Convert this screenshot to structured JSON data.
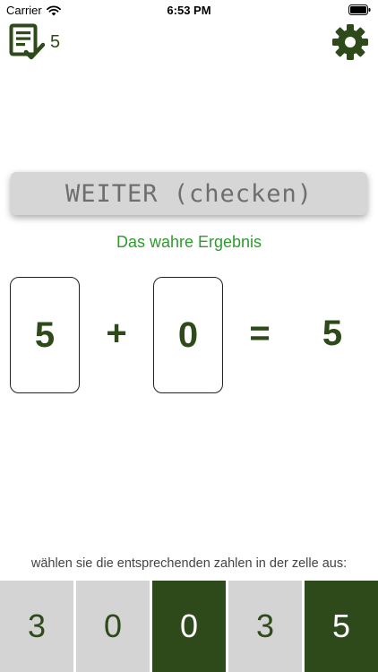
{
  "status_bar": {
    "carrier": "Carrier",
    "time": "6:53 PM"
  },
  "toolbar": {
    "score": "5",
    "left_icon": "checklist-icon",
    "right_icon": "gear-icon"
  },
  "next_button": {
    "label": "WEITER (checken)"
  },
  "result_caption": "Das wahre Ergebnis",
  "equation": {
    "operand_a": "5",
    "operator": "+",
    "operand_b": "0",
    "equals": "=",
    "result": "5"
  },
  "instruction": "wählen sie die entsprechenden zahlen in der zelle aus:",
  "digit_buttons": [
    {
      "label": "3",
      "selected": false
    },
    {
      "label": "0",
      "selected": false
    },
    {
      "label": "0",
      "selected": true
    },
    {
      "label": "3",
      "selected": false
    },
    {
      "label": "5",
      "selected": true
    }
  ],
  "colors": {
    "accent_dark_green": "#2e4a1a",
    "caption_green": "#2f9a2f",
    "button_gray": "#d4d4d4"
  }
}
